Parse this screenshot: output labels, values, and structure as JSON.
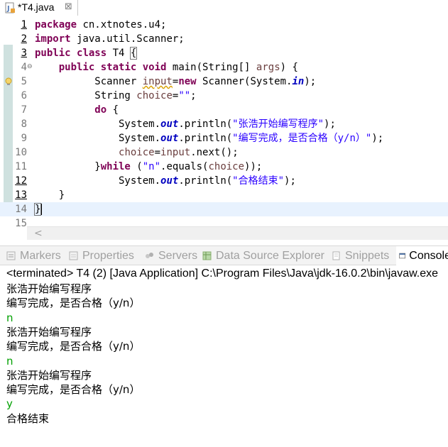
{
  "editor_tab": {
    "title": "*T4.java",
    "close": "⊠"
  },
  "code_lines": [
    {
      "num": "1",
      "tokens": [
        {
          "t": "package",
          "c": "kw"
        },
        {
          "t": " cn.xtnotes.u4;",
          "c": ""
        }
      ]
    },
    {
      "num": "2",
      "tokens": [
        {
          "t": "import",
          "c": "kw"
        },
        {
          "t": " java.util.Scanner;",
          "c": ""
        }
      ]
    },
    {
      "num": "3",
      "tokens": [
        {
          "t": "public",
          "c": "kw"
        },
        {
          "t": " ",
          "c": ""
        },
        {
          "t": "class",
          "c": "kw"
        },
        {
          "t": " T4 ",
          "c": ""
        },
        {
          "t": "{",
          "c": "brace-box"
        }
      ]
    },
    {
      "num": "4",
      "tokens": [
        {
          "t": "    ",
          "c": ""
        },
        {
          "t": "public",
          "c": "kw"
        },
        {
          "t": " ",
          "c": ""
        },
        {
          "t": "static",
          "c": "kw"
        },
        {
          "t": " ",
          "c": ""
        },
        {
          "t": "void",
          "c": "kw"
        },
        {
          "t": " main(String[] ",
          "c": ""
        },
        {
          "t": "args",
          "c": "var"
        },
        {
          "t": ") {",
          "c": ""
        }
      ]
    },
    {
      "num": "5",
      "tokens": [
        {
          "t": "          Scanner ",
          "c": ""
        },
        {
          "t": "input",
          "c": "var warn"
        },
        {
          "t": "=",
          "c": ""
        },
        {
          "t": "new",
          "c": "kw"
        },
        {
          "t": " Scanner(System.",
          "c": ""
        },
        {
          "t": "in",
          "c": "sfld"
        },
        {
          "t": ");",
          "c": ""
        }
      ]
    },
    {
      "num": "6",
      "tokens": [
        {
          "t": "          String ",
          "c": ""
        },
        {
          "t": "choice",
          "c": "var"
        },
        {
          "t": "=",
          "c": ""
        },
        {
          "t": "\"\"",
          "c": "str"
        },
        {
          "t": ";",
          "c": ""
        }
      ]
    },
    {
      "num": "7",
      "tokens": [
        {
          "t": "          ",
          "c": ""
        },
        {
          "t": "do",
          "c": "kw"
        },
        {
          "t": " {",
          "c": ""
        }
      ]
    },
    {
      "num": "8",
      "tokens": [
        {
          "t": "              System.",
          "c": ""
        },
        {
          "t": "out",
          "c": "sfld"
        },
        {
          "t": ".println(",
          "c": ""
        },
        {
          "t": "\"张浩开始编写程序\"",
          "c": "str"
        },
        {
          "t": ");",
          "c": ""
        }
      ]
    },
    {
      "num": "9",
      "tokens": [
        {
          "t": "              System.",
          "c": ""
        },
        {
          "t": "out",
          "c": "sfld"
        },
        {
          "t": ".println(",
          "c": ""
        },
        {
          "t": "\"编写完成，是否合格（y/n）\"",
          "c": "str"
        },
        {
          "t": ");",
          "c": ""
        }
      ]
    },
    {
      "num": "10",
      "tokens": [
        {
          "t": "              ",
          "c": ""
        },
        {
          "t": "choice",
          "c": "var"
        },
        {
          "t": "=",
          "c": ""
        },
        {
          "t": "input",
          "c": "var"
        },
        {
          "t": ".next();",
          "c": ""
        }
      ]
    },
    {
      "num": "11",
      "tokens": [
        {
          "t": "          }",
          "c": ""
        },
        {
          "t": "while",
          "c": "kw"
        },
        {
          "t": " (",
          "c": ""
        },
        {
          "t": "\"n\"",
          "c": "str"
        },
        {
          "t": ".equals(",
          "c": ""
        },
        {
          "t": "choice",
          "c": "var"
        },
        {
          "t": "));",
          "c": ""
        }
      ]
    },
    {
      "num": "12",
      "tokens": [
        {
          "t": "              System.",
          "c": ""
        },
        {
          "t": "out",
          "c": "sfld"
        },
        {
          "t": ".println(",
          "c": ""
        },
        {
          "t": "\"合格结束\"",
          "c": "str"
        },
        {
          "t": ");",
          "c": ""
        }
      ]
    },
    {
      "num": "13",
      "tokens": [
        {
          "t": "    }",
          "c": ""
        }
      ]
    },
    {
      "num": "14",
      "tokens": [
        {
          "t": "}",
          "c": "brace-box"
        }
      ]
    },
    {
      "num": "15",
      "tokens": []
    }
  ],
  "views": {
    "markers": "Markers",
    "properties": "Properties",
    "servers": "Servers",
    "data_source_explorer": "Data Source Explorer",
    "snippets": "Snippets",
    "console": "Console"
  },
  "console": {
    "status": "<terminated> T4 (2) [Java Application] C:\\Program Files\\Java\\jdk-16.0.2\\bin\\javaw.exe",
    "lines": [
      {
        "text": "张浩开始编写程序",
        "type": "out"
      },
      {
        "text": "编写完成，是否合格（y/n）",
        "type": "out"
      },
      {
        "text": "n",
        "type": "in"
      },
      {
        "text": "张浩开始编写程序",
        "type": "out"
      },
      {
        "text": "编写完成，是否合格（y/n）",
        "type": "out"
      },
      {
        "text": "n",
        "type": "in"
      },
      {
        "text": "张浩开始编写程序",
        "type": "out"
      },
      {
        "text": "编写完成，是否合格（y/n）",
        "type": "out"
      },
      {
        "text": "y",
        "type": "in"
      },
      {
        "text": "合格结束",
        "type": "out"
      }
    ]
  },
  "colors": {
    "keyword": "#7f0055",
    "string": "#2a00ff",
    "field": "#0000c0",
    "user_input": "#00a000",
    "current_line": "#e8f2fe"
  }
}
